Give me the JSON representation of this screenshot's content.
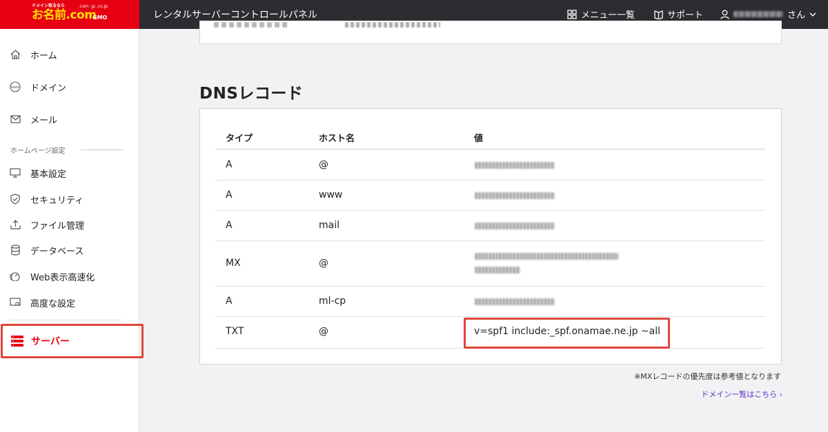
{
  "header": {
    "logo_tagline": "ドメイン取るなら",
    "logo_text": "お名前.com",
    "logo_domains": ".com .jp .co.jp",
    "logo_brand": "GMO",
    "panel_title": "レンタルサーバーコントロールパネル",
    "menu_label": "メニュー一覧",
    "support_label": "サポート",
    "user_suffix": "さん",
    "icons": {
      "menu": "grid-icon",
      "support": "book-icon",
      "user": "user-icon",
      "chevron": "chevron-down-icon"
    }
  },
  "sidebar": {
    "items": [
      {
        "label": "ホーム",
        "icon": "home-icon"
      },
      {
        "label": "ドメイン",
        "icon": "www-icon"
      },
      {
        "label": "メール",
        "icon": "mail-icon"
      }
    ],
    "section_label": "ホームページ設定",
    "site_items": [
      {
        "label": "基本設定",
        "icon": "monitor-icon"
      },
      {
        "label": "セキュリティ",
        "icon": "shield-icon"
      },
      {
        "label": "ファイル管理",
        "icon": "upload-icon"
      },
      {
        "label": "データベース",
        "icon": "database-icon"
      },
      {
        "label": "Web表示高速化",
        "icon": "speed-icon"
      },
      {
        "label": "高度な設定",
        "icon": "settings-monitor-icon"
      }
    ],
    "server_item": {
      "label": "サーバー",
      "icon": "server-icon"
    }
  },
  "dns": {
    "title": "DNSレコード",
    "columns": {
      "type": "タイプ",
      "host": "ホスト名",
      "value": "値"
    },
    "rows": [
      {
        "type": "A",
        "host": "@"
      },
      {
        "type": "A",
        "host": "www"
      },
      {
        "type": "A",
        "host": "mail"
      },
      {
        "type": "MX",
        "host": "@"
      },
      {
        "type": "A",
        "host": "ml-cp"
      },
      {
        "type": "TXT",
        "host": "@",
        "value": "v=spf1 include:_spf.onamae.ne.jp ~all"
      }
    ],
    "note": "※MXレコードの優先度は参考値となります",
    "domain_link": "ドメイン一覧はこちら ›"
  },
  "colors": {
    "brand_red": "#e60012",
    "highlight": "#e0453a",
    "header_bg": "#2b2d31",
    "link": "#5a2fc2"
  }
}
